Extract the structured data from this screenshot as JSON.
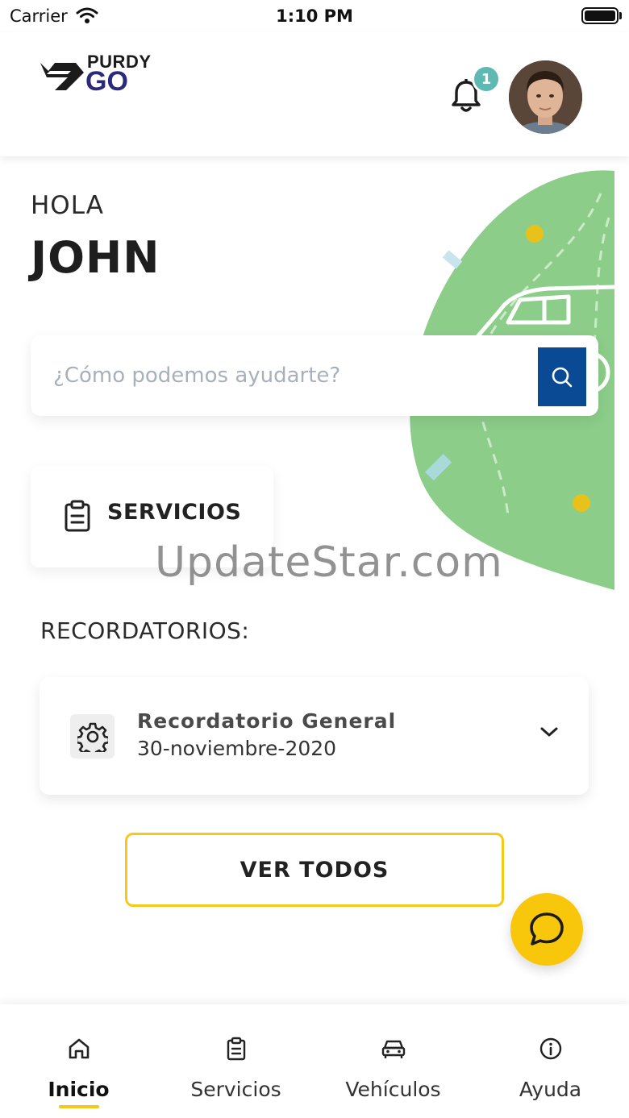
{
  "status_bar": {
    "carrier": "Carrier",
    "time": "1:10 PM"
  },
  "header": {
    "logo_top": "PURDY",
    "logo_bottom": "GO",
    "notification_count": "1"
  },
  "greeting": {
    "hello": "HOLA",
    "name": "JOHN"
  },
  "search": {
    "placeholder": "¿Cómo podemos ayudarte?",
    "value": ""
  },
  "services_card": {
    "label": "SERVICIOS",
    "icon": "clipboard-icon"
  },
  "watermark": "UpdateStar.com",
  "reminders": {
    "title": "RECORDATORIOS:",
    "items": [
      {
        "title": "Recordatorio General",
        "date": "30-noviembre-2020",
        "icon": "gear-icon"
      }
    ],
    "view_all": "VER TODOS"
  },
  "tabs": [
    {
      "label": "Inicio",
      "icon": "home-icon",
      "active": true
    },
    {
      "label": "Servicios",
      "icon": "clipboard-icon",
      "active": false
    },
    {
      "label": "Vehículos",
      "icon": "car-icon",
      "active": false
    },
    {
      "label": "Ayuda",
      "icon": "info-icon",
      "active": false
    }
  ],
  "colors": {
    "brand_blue": "#0a4a94",
    "accent_yellow": "#f6c919",
    "badge_teal": "#5eb9b2",
    "decor_green": "#8ccd8a",
    "logo_navy": "#2b2a7a"
  }
}
